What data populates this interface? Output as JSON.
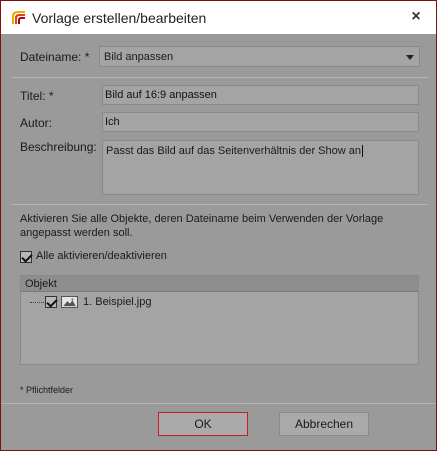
{
  "window": {
    "title": "Vorlage erstellen/bearbeiten",
    "close_label": "×"
  },
  "form": {
    "dateiname_label": "Dateiname: *",
    "dateiname_value": "Bild anpassen",
    "titel_label": "Titel: *",
    "titel_value": "Bild auf 16:9 anpassen",
    "autor_label": "Autor:",
    "autor_value": "Ich",
    "beschreibung_label": "Beschreibung:",
    "beschreibung_value": "Passt das Bild auf das Seitenverhältnis der Show an"
  },
  "objects": {
    "info_text": "Aktivieren Sie alle Objekte, deren Dateiname beim Verwenden der Vorlage angepasst werden soll.",
    "toggle_all_label": "Alle aktivieren/deaktivieren",
    "toggle_all_checked": true,
    "column_header": "Objekt",
    "rows": [
      {
        "label": "1. Beispiel.jpg",
        "checked": true,
        "icon": "image-icon"
      }
    ]
  },
  "footnote": "* Pflichtfelder",
  "buttons": {
    "ok_label": "OK",
    "cancel_label": "Abbrechen"
  },
  "colors": {
    "accent": "#c8201f",
    "window_bg": "#9a9a9a",
    "field_bg": "#a4a4a4"
  }
}
